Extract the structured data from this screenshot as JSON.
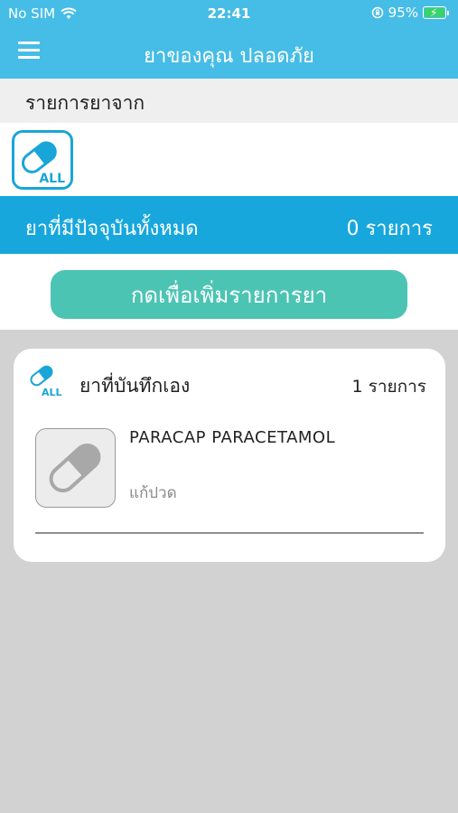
{
  "status_bar": {
    "carrier": "No SIM",
    "time": "22:41",
    "battery_percent": "95%"
  },
  "nav": {
    "title": "ยาของคุณ ปลอดภัย",
    "menu_icon": "hamburger-icon"
  },
  "source": {
    "header": "รายการยาจาก",
    "filters": [
      {
        "label": "ALL",
        "icon": "pill-icon",
        "selected": true
      }
    ]
  },
  "summary": {
    "label": "ยาที่มีปัจจุบันทั้งหมด",
    "count": "0 รายการ"
  },
  "add_button": {
    "label": "กดเพื่อเพิ่มรายการยา"
  },
  "self_recorded": {
    "icon_label": "ALL",
    "title": "ยาที่บันทึกเอง",
    "count": "1 รายการ",
    "items": [
      {
        "name": "PARACAP PARACETAMOL",
        "use": "แก้ปวด",
        "thumb_icon": "pill-icon"
      }
    ]
  },
  "colors": {
    "header_blue": "#46bde6",
    "summary_blue": "#17a7dd",
    "button_teal": "#4cc4b4",
    "icon_blue": "#1aa5d8"
  }
}
